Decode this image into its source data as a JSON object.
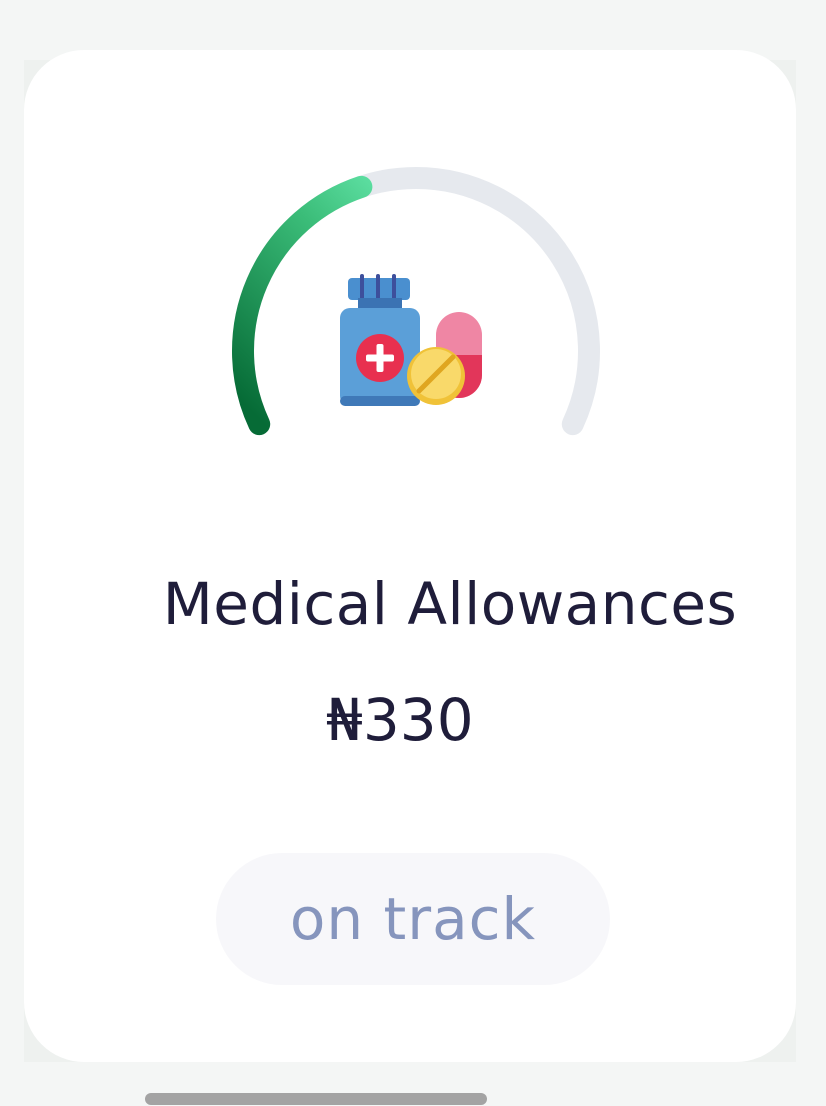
{
  "card": {
    "title": "Medical Allowances",
    "amount": "₦330",
    "status": "on track",
    "icon": "medicine-icon",
    "progress_fraction": 0.42
  },
  "colors": {
    "gauge_start": "#066b36",
    "gauge_mid": "#3bbd79",
    "gauge_end": "#7dffc8",
    "gauge_track": "#e6e9ee",
    "title_text": "#1f1d3a",
    "status_text": "#8695bd",
    "status_background": "#f7f7fa"
  }
}
